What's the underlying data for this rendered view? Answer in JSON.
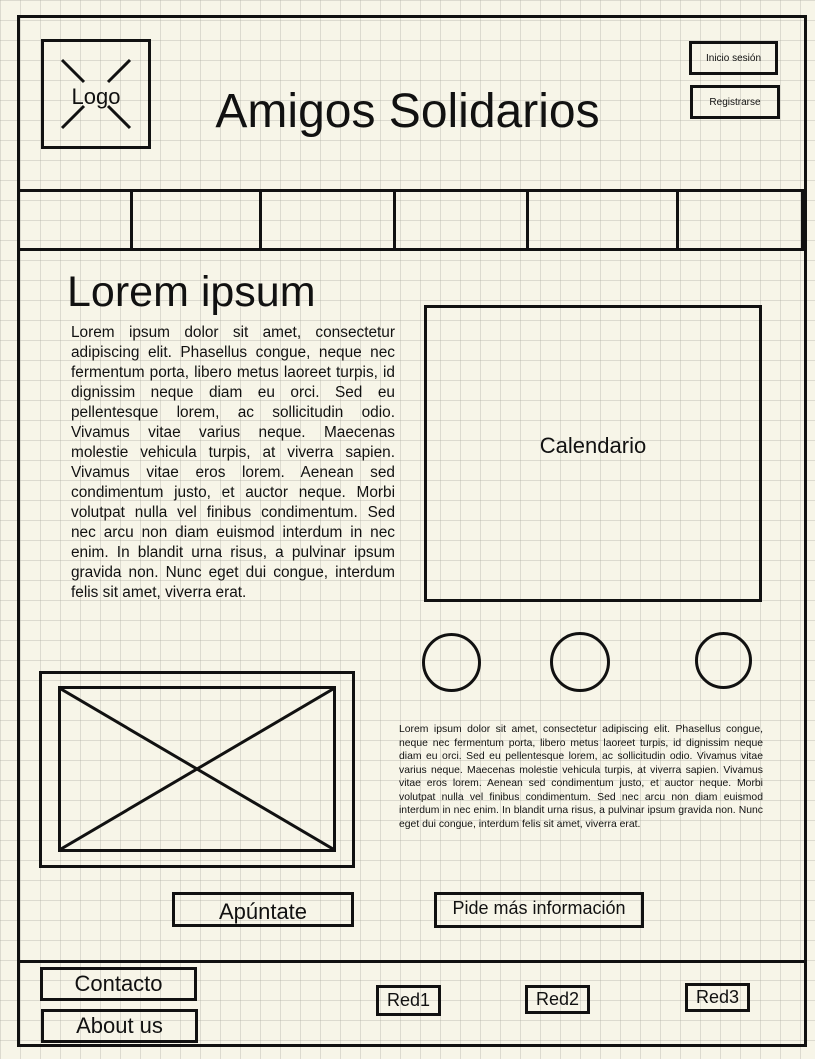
{
  "header": {
    "logo_label": "Logo",
    "site_title": "Amigos Solidarios",
    "login_label": "Inicio sesión",
    "register_label": "Registrarse"
  },
  "main": {
    "heading": "Lorem ipsum",
    "text": "Lorem ipsum dolor sit amet, consectetur adipiscing elit. Phasellus congue, neque nec fermentum porta, libero metus laoreet turpis, id dignissim neque diam eu orci. Sed eu pellentesque lorem, ac sollicitudin odio. Vivamus vitae varius neque. Maecenas molestie vehicula turpis, at viverra sapien. Vivamus vitae eros lorem. Aenean sed condimentum justo, et auctor neque. Morbi volutpat nulla vel finibus condimentum. Sed nec arcu non diam euismod interdum in nec enim. In blandit urna risus, a pulvinar ipsum gravida non. Nunc eget dui congue, interdum felis sit amet, viverra erat.",
    "calendar_label": "Calendario",
    "small_text": "Lorem ipsum dolor sit amet, consectetur adipiscing elit. Phasellus congue, neque nec fermentum porta, libero metus laoreet turpis, id dignissim neque diam eu orci. Sed eu pellentesque lorem, ac sollicitudin odio. Vivamus vitae varius neque. Maecenas molestie vehicula turpis, at viverra sapien. Vivamus vitae eros lorem. Aenean sed condimentum justo, et auctor neque. Morbi volutpat nulla vel finibus condimentum. Sed nec arcu non diam euismod interdum in nec enim. In blandit urna risus, a pulvinar ipsum gravida non. Nunc eget dui congue, interdum felis sit amet, viverra erat.",
    "signup_label": "Apúntate",
    "info_label": "Pide más información"
  },
  "footer": {
    "contact_label": "Contacto",
    "about_label": "About us",
    "red1_label": "Red1",
    "red2_label": "Red2",
    "red3_label": "Red3"
  }
}
